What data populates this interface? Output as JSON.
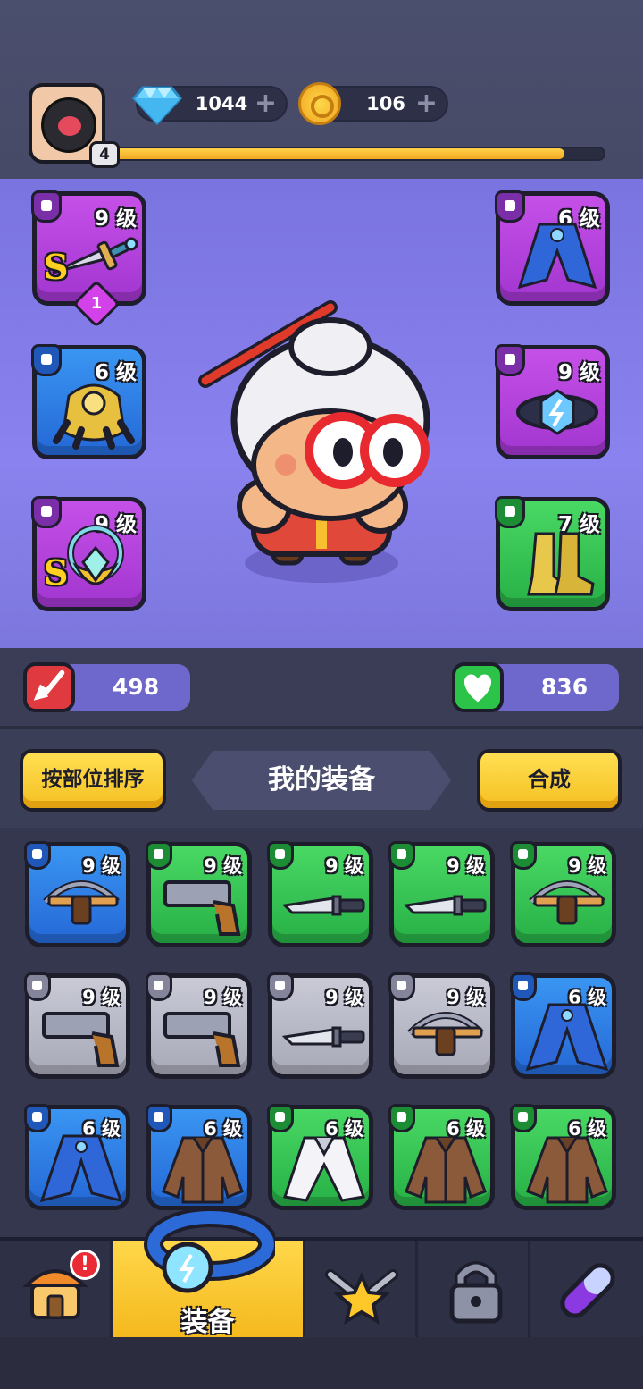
{
  "header": {
    "player_level": "4",
    "xp_progress": 0.92,
    "gems": "1044",
    "coins": "106"
  },
  "equipped": {
    "left": [
      {
        "type": "weapon",
        "level": "9 级",
        "rarity": "purple",
        "rank": "S",
        "stars": "1",
        "icon": "dagger-icon"
      },
      {
        "type": "gloves",
        "level": "6 级",
        "rarity": "blue",
        "icon": "gauntlet-icon"
      },
      {
        "type": "amulet",
        "level": "9 级",
        "rarity": "purple",
        "rank": "S",
        "icon": "amulet-icon"
      }
    ],
    "right": [
      {
        "type": "armor",
        "level": "6 级",
        "rarity": "purple",
        "icon": "robe-icon"
      },
      {
        "type": "belt",
        "level": "9 级",
        "rarity": "purple",
        "icon": "belt-icon"
      },
      {
        "type": "boots",
        "level": "7 级",
        "rarity": "green",
        "icon": "boots-icon"
      }
    ]
  },
  "stats": {
    "attack": "498",
    "health": "836"
  },
  "inventory": {
    "sort_label": "按部位排序",
    "title": "我的装备",
    "merge_label": "合成",
    "items": [
      {
        "level": "9 级",
        "rarity": "blue",
        "icon": "crossbow-icon"
      },
      {
        "level": "9 级",
        "rarity": "green",
        "icon": "revolver-icon"
      },
      {
        "level": "9 级",
        "rarity": "green",
        "icon": "knife-icon"
      },
      {
        "level": "9 级",
        "rarity": "green",
        "icon": "knife-icon"
      },
      {
        "level": "9 级",
        "rarity": "green",
        "icon": "crossbow-icon"
      },
      {
        "level": "9 级",
        "rarity": "gray",
        "icon": "revolver-icon"
      },
      {
        "level": "9 级",
        "rarity": "gray",
        "icon": "revolver-icon"
      },
      {
        "level": "9 级",
        "rarity": "gray",
        "icon": "knife-icon"
      },
      {
        "level": "9 级",
        "rarity": "gray",
        "icon": "crossbow-icon"
      },
      {
        "level": "6 级",
        "rarity": "blue",
        "icon": "robe-icon"
      },
      {
        "level": "6 级",
        "rarity": "blue",
        "icon": "robe-icon"
      },
      {
        "level": "6 级",
        "rarity": "blue",
        "icon": "jacket-icon"
      },
      {
        "level": "6 级",
        "rarity": "green",
        "icon": "white-coat-icon"
      },
      {
        "level": "6 级",
        "rarity": "green",
        "icon": "jacket-icon"
      },
      {
        "level": "6 级",
        "rarity": "green",
        "icon": "jacket-icon"
      }
    ]
  },
  "nav": {
    "active_label": "装备",
    "shop_alert": "!"
  }
}
